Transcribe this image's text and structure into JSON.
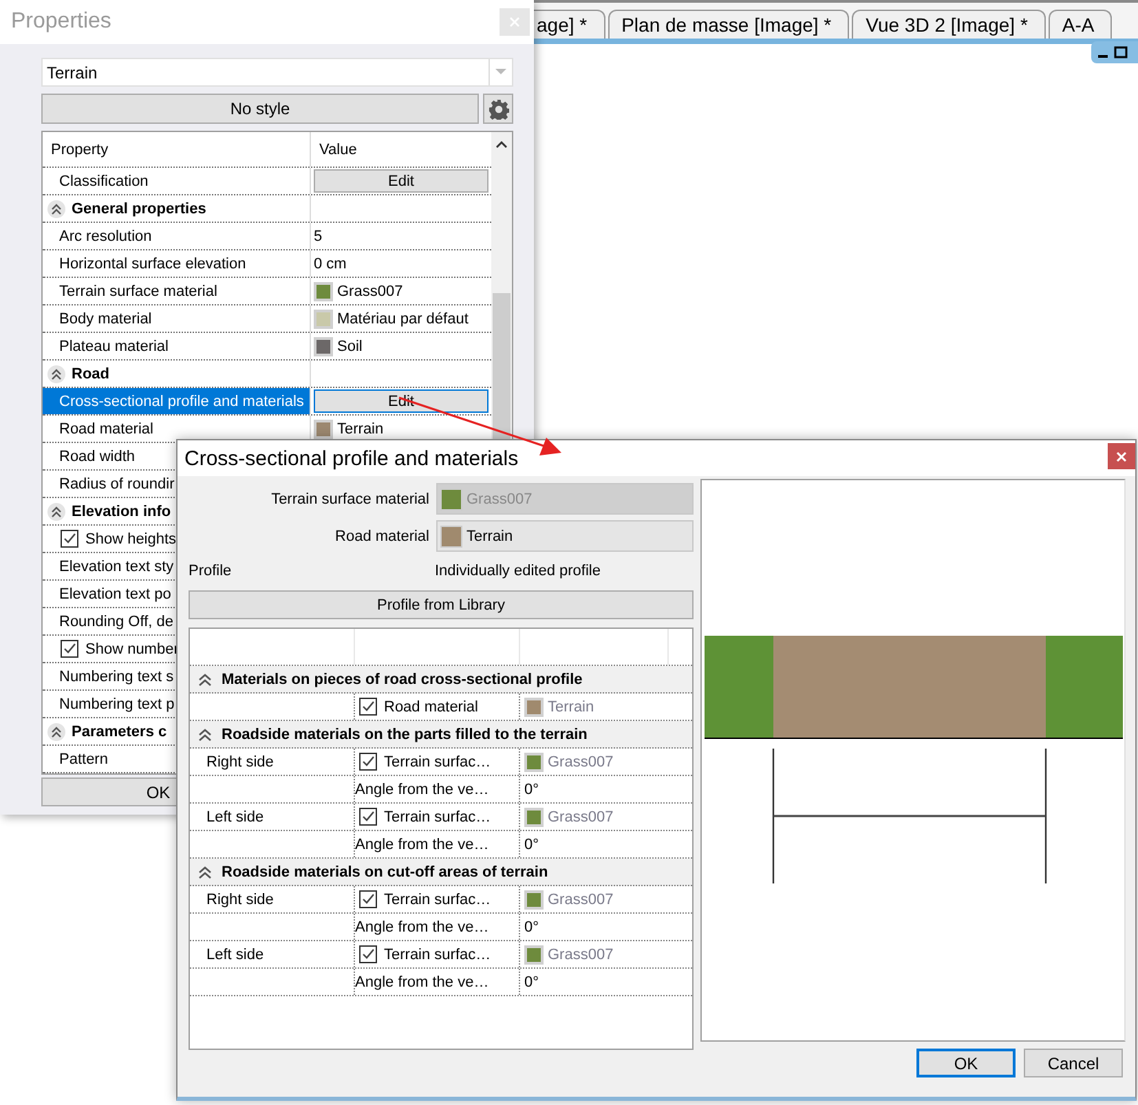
{
  "tab_bar": {
    "tabs": [
      {
        "label": "age] *",
        "selected": false
      },
      {
        "label": "Plan de masse [Image] *",
        "selected": false
      },
      {
        "label": "Vue 3D 2 [Image] *",
        "selected": false
      },
      {
        "label": "A-A",
        "selected": false
      }
    ]
  },
  "properties_window": {
    "title": "Properties",
    "object_select": {
      "value": "Terrain"
    },
    "style_button": "No style",
    "columns": [
      "Property",
      "Value"
    ],
    "rows": [
      {
        "kind": "button",
        "label": "Classification",
        "value": "Edit",
        "selected": false
      },
      {
        "kind": "group",
        "label": "General properties",
        "expanded": true,
        "selected": false
      },
      {
        "kind": "text",
        "label": "Arc resolution",
        "value": "5",
        "selected": false
      },
      {
        "kind": "text",
        "label": "Horizontal surface elevation",
        "value": "0 cm",
        "selected": false
      },
      {
        "kind": "material",
        "label": "Terrain surface material",
        "value": "Grass007",
        "color": "#6e8b3d",
        "selected": false
      },
      {
        "kind": "material",
        "label": "Body material",
        "value": "Matériau par défaut",
        "color": "#c9c9a9",
        "selected": false
      },
      {
        "kind": "material",
        "label": "Plateau material",
        "value": "Soil",
        "color": "#6c6868",
        "selected": false
      },
      {
        "kind": "group",
        "label": "Road",
        "expanded": true,
        "selected": false
      },
      {
        "kind": "button",
        "label": "Cross-sectional profile and materials",
        "value": "Edit",
        "selected": true
      },
      {
        "kind": "material",
        "label": "Road material",
        "value": "Terrain",
        "color": "#9c8870",
        "selected": false
      },
      {
        "kind": "text",
        "label": "Road width",
        "selected": false
      },
      {
        "kind": "text",
        "label": "Radius of roundir",
        "selected": false
      },
      {
        "kind": "group",
        "label": "Elevation info",
        "expanded": true,
        "selected": false
      },
      {
        "kind": "checkbox",
        "label": "Show heights",
        "checked": true,
        "selected": false
      },
      {
        "kind": "text",
        "label": "Elevation text sty",
        "selected": false
      },
      {
        "kind": "text",
        "label": "Elevation text po",
        "selected": false
      },
      {
        "kind": "text",
        "label": "Rounding Off, de",
        "selected": false
      },
      {
        "kind": "checkbox",
        "label": "Show number",
        "checked": true,
        "selected": false
      },
      {
        "kind": "text",
        "label": "Numbering text s",
        "selected": false
      },
      {
        "kind": "text",
        "label": "Numbering text p",
        "selected": false
      },
      {
        "kind": "group",
        "label": "Parameters c",
        "expanded": true,
        "selected": false
      },
      {
        "kind": "text",
        "label": "Pattern",
        "selected": false
      }
    ],
    "ok_button": "OK"
  },
  "dialog": {
    "title": "Cross-sectional profile and materials",
    "fields": [
      {
        "label": "Terrain surface material",
        "value": "Grass007",
        "color": "#6e8b3d",
        "disabled": true
      },
      {
        "label": "Road material",
        "value": "Terrain",
        "color": "#a08a6e",
        "disabled": false
      }
    ],
    "profile_label": "Profile",
    "profile_value": "Individually edited profile",
    "library_button": "Profile from Library",
    "material_rows": [
      {
        "kind": "group",
        "label": "Materials on pieces of road cross-sectional profile",
        "expanded": true
      },
      {
        "kind": "material",
        "check_label": "Road material",
        "checked": true,
        "value": "Terrain",
        "color": "#a08a6e"
      },
      {
        "kind": "group",
        "label": "Roadside materials on the parts filled to the terrain",
        "expanded": true
      },
      {
        "kind": "material",
        "side": "Right side",
        "check_label": "Terrain surfac…",
        "checked": true,
        "value": "Grass007",
        "color": "#6e8b3d"
      },
      {
        "kind": "angle",
        "name": "Angle from the ve…",
        "value": "0°"
      },
      {
        "kind": "material",
        "side": "Left side",
        "check_label": "Terrain surfac…",
        "checked": true,
        "value": "Grass007",
        "color": "#6e8b3d"
      },
      {
        "kind": "angle",
        "name": "Angle from the ve…",
        "value": "0°"
      },
      {
        "kind": "group",
        "label": "Roadside materials on cut-off areas of terrain",
        "expanded": true
      },
      {
        "kind": "material",
        "side": "Right side",
        "check_label": "Terrain surfac…",
        "checked": true,
        "value": "Grass007",
        "color": "#6e8b3d"
      },
      {
        "kind": "angle",
        "name": "Angle from the ve…",
        "value": "0°"
      },
      {
        "kind": "material",
        "side": "Left side",
        "check_label": "Terrain surfac…",
        "checked": true,
        "value": "Grass007",
        "color": "#6e8b3d"
      },
      {
        "kind": "angle",
        "name": "Angle from the ve…",
        "value": "0°"
      }
    ],
    "buttons": [
      {
        "label": "OK",
        "default": true
      },
      {
        "label": "Cancel",
        "default": false
      }
    ]
  }
}
